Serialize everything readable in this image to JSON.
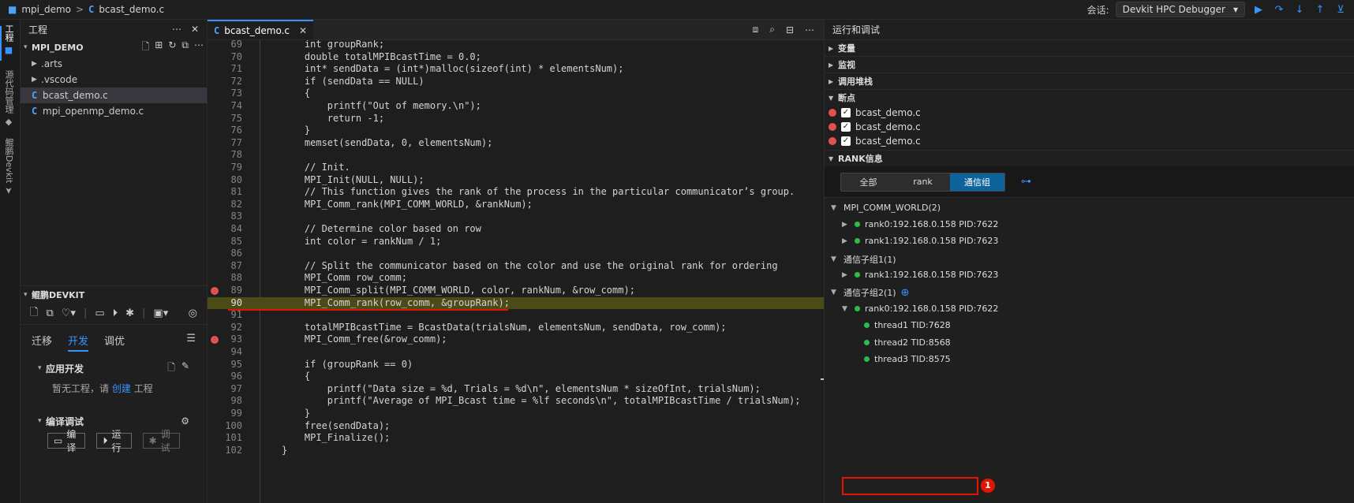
{
  "titlebar": {
    "project": "mpi_demo",
    "sep": ">",
    "file": "bcast_demo.c",
    "session_label": "会话:",
    "session_value": "Devkit HPC Debugger"
  },
  "activity": {
    "project_tab": "工程",
    "source_tab": "源代码管理",
    "devkit_tab": "鲲鹏Devkit"
  },
  "sidebar": {
    "title": "工程",
    "project": "MPI_DEMO",
    "items": [
      {
        "label": ".arts",
        "type": "folder"
      },
      {
        "label": ".vscode",
        "type": "folder"
      },
      {
        "label": "bcast_demo.c",
        "type": "c"
      },
      {
        "label": "mpi_openmp_demo.c",
        "type": "c"
      }
    ],
    "devkit": {
      "title": "鲲鹏DEVKIT",
      "tabs": [
        "迁移",
        "开发",
        "调优"
      ],
      "app_dev": "应用开发",
      "no_project": "暂无工程，请",
      "create": "创建",
      "project_word": "工程",
      "build_debug": "编译调试",
      "btn_compile": "编译",
      "btn_run": "运行",
      "btn_debug": "调试"
    }
  },
  "editor": {
    "tab": "bcast_demo.c",
    "lines": [
      {
        "n": "69",
        "t": "    int groupRank;"
      },
      {
        "n": "70",
        "t": "    double totalMPIBcastTime = 0.0;"
      },
      {
        "n": "71",
        "t": "    int* sendData = (int*)malloc(sizeof(int) * elementsNum);"
      },
      {
        "n": "72",
        "t": "    if (sendData == NULL)"
      },
      {
        "n": "73",
        "t": "    {"
      },
      {
        "n": "74",
        "t": "        printf(\"Out of memory.\\n\");"
      },
      {
        "n": "75",
        "t": "        return -1;"
      },
      {
        "n": "76",
        "t": "    }"
      },
      {
        "n": "77",
        "t": "    memset(sendData, 0, elementsNum);"
      },
      {
        "n": "78",
        "t": ""
      },
      {
        "n": "79",
        "t": "    // Init."
      },
      {
        "n": "80",
        "t": "    MPI_Init(NULL, NULL);"
      },
      {
        "n": "81",
        "t": "    // This function gives the rank of the process in the particular communicator’s group."
      },
      {
        "n": "82",
        "t": "    MPI_Comm_rank(MPI_COMM_WORLD, &rankNum);"
      },
      {
        "n": "83",
        "t": ""
      },
      {
        "n": "84",
        "t": "    // Determine color based on row"
      },
      {
        "n": "85",
        "t": "    int color = rankNum / 1;"
      },
      {
        "n": "86",
        "t": ""
      },
      {
        "n": "87",
        "t": "    // Split the communicator based on the color and use the original rank for ordering"
      },
      {
        "n": "88",
        "t": "    MPI_Comm row_comm;"
      },
      {
        "n": "89",
        "t": "    MPI_Comm_split(MPI_COMM_WORLD, color, rankNum, &row_comm);"
      },
      {
        "n": "90",
        "t": "    MPI_Comm_rank(row_comm, &groupRank);"
      },
      {
        "n": "91",
        "t": ""
      },
      {
        "n": "92",
        "t": "    totalMPIBcastTime = BcastData(trialsNum, elementsNum, sendData, row_comm);"
      },
      {
        "n": "93",
        "t": "    MPI_Comm_free(&row_comm);"
      },
      {
        "n": "94",
        "t": ""
      },
      {
        "n": "95",
        "t": "    if (groupRank == 0)"
      },
      {
        "n": "96",
        "t": "    {"
      },
      {
        "n": "97",
        "t": "        printf(\"Data size = %d, Trials = %d\\n\", elementsNum * sizeOfInt, trialsNum);"
      },
      {
        "n": "98",
        "t": "        printf(\"Average of MPI_Bcast time = %lf seconds\\n\", totalMPIBcastTime / trialsNum);"
      },
      {
        "n": "99",
        "t": "    }"
      },
      {
        "n": "100",
        "t": "    free(sendData);"
      },
      {
        "n": "101",
        "t": "    MPI_Finalize();"
      },
      {
        "n": "102",
        "t": "}"
      }
    ],
    "breakpoint_lines": [
      "89",
      "93"
    ],
    "current_line": "90"
  },
  "panel": {
    "title": "运行和调试",
    "variables": "变量",
    "watch": "监视",
    "callstack": "调用堆栈",
    "breakpoints": "断点",
    "bp_files": [
      "bcast_demo.c",
      "bcast_demo.c",
      "bcast_demo.c"
    ],
    "rank_info": "RANK信息",
    "seg": [
      "全部",
      "rank",
      "通信组"
    ],
    "world": "MPI_COMM_WORLD(2)",
    "world_ranks": [
      "rank0:192.168.0.158 PID:7622",
      "rank1:192.168.0.158 PID:7623"
    ],
    "sub1": "通信子组1(1)",
    "sub1_ranks": [
      "rank1:192.168.0.158 PID:7623"
    ],
    "sub2": "通信子组2(1)",
    "sub2_rank": "rank0:192.168.0.158 PID:7622",
    "threads": [
      "thread1 TID:7628",
      "thread2 TID:8568",
      "thread3 TID:8575"
    ],
    "badge": "1"
  },
  "colors": {
    "accent": "#3794ff",
    "breakpoint": "#e05252",
    "status_ok": "#2bbd4b",
    "annotation": "#e51400"
  }
}
